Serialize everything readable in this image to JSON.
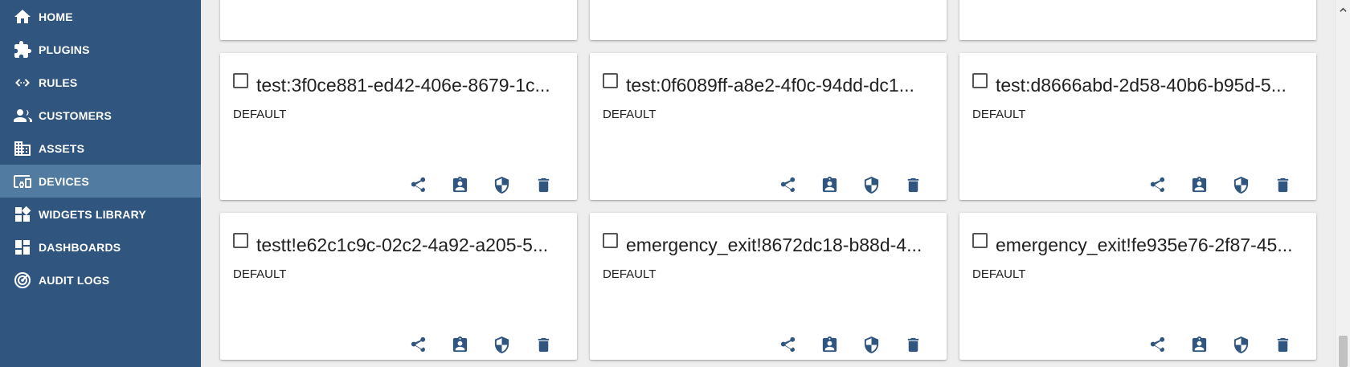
{
  "sidebar": {
    "items": [
      {
        "label": "HOME",
        "icon": "home-icon",
        "active": false
      },
      {
        "label": "PLUGINS",
        "icon": "puzzle-icon",
        "active": false
      },
      {
        "label": "RULES",
        "icon": "code-arrows-icon",
        "active": false
      },
      {
        "label": "CUSTOMERS",
        "icon": "people-icon",
        "active": false
      },
      {
        "label": "ASSETS",
        "icon": "building-icon",
        "active": false
      },
      {
        "label": "DEVICES",
        "icon": "devices-icon",
        "active": true
      },
      {
        "label": "WIDGETS LIBRARY",
        "icon": "widgets-icon",
        "active": false
      },
      {
        "label": "DASHBOARDS",
        "icon": "dashboard-icon",
        "active": false
      },
      {
        "label": "AUDIT LOGS",
        "icon": "radar-icon",
        "active": false
      }
    ],
    "colors": {
      "background": "#305680",
      "active": "#527ba1"
    }
  },
  "devices": {
    "cards": [
      {
        "title": "",
        "type": ""
      },
      {
        "title": "",
        "type": ""
      },
      {
        "title": "",
        "type": ""
      },
      {
        "title": "test:3f0ce881-ed42-406e-8679-1c...",
        "type": "DEFAULT"
      },
      {
        "title": "test:0f6089ff-a8e2-4f0c-94dd-dc1...",
        "type": "DEFAULT"
      },
      {
        "title": "test:d8666abd-2d58-40b6-b95d-5...",
        "type": "DEFAULT"
      },
      {
        "title": "testt!e62c1c9c-02c2-4a92-a205-5...",
        "type": "DEFAULT"
      },
      {
        "title": "emergency_exit!8672dc18-b88d-4...",
        "type": "DEFAULT"
      },
      {
        "title": "emergency_exit!fe935e76-2f87-45...",
        "type": "DEFAULT"
      }
    ],
    "action_icons": [
      "share-icon",
      "assign-customer-icon",
      "credentials-shield-icon",
      "delete-icon"
    ],
    "icon_color": "#305680"
  }
}
